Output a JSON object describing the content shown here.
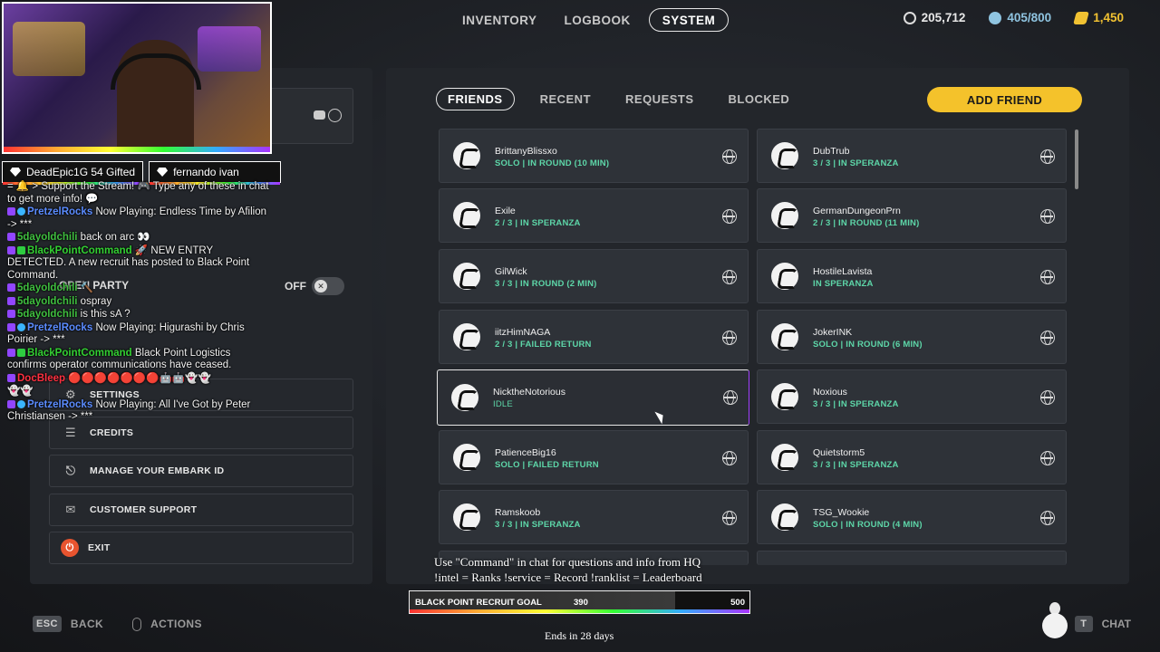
{
  "nav": {
    "tabs": [
      {
        "label": "INVENTORY"
      },
      {
        "label": "LOGBOOK"
      },
      {
        "label": "SYSTEM"
      }
    ]
  },
  "currencies": {
    "coins": "205,712",
    "capacity": "405/800",
    "premium": "1,450",
    "colors": {
      "capacity": "#8fc4e0",
      "premium": "#f1c232"
    }
  },
  "system_menu": {
    "party_label": "OPEN PARTY",
    "party_toggle": "OFF",
    "items": [
      {
        "label": "SETTINGS",
        "icon": "gear-icon"
      },
      {
        "label": "CREDITS",
        "icon": "list-icon"
      },
      {
        "label": "MANAGE YOUR EMBARK ID",
        "icon": "embark-icon"
      },
      {
        "label": "CUSTOMER SUPPORT",
        "icon": "chat-icon"
      },
      {
        "label": "EXIT",
        "icon": "power-icon"
      }
    ]
  },
  "stream": {
    "gifts": [
      {
        "text": "DeadEpic1G 54 Gifted"
      },
      {
        "text": "fernando ivan"
      }
    ],
    "chat": [
      {
        "user": "",
        "text": "= 🔔 > Support the Stream! 🎮 Type any of these in chat to get more info! 💬"
      },
      {
        "user": "PretzelRocks",
        "text": "Now Playing: Endless Time by Afilion -> ***"
      },
      {
        "user": "5dayoldchili",
        "text": "back on arc 👀"
      },
      {
        "user": "BlackPointCommand",
        "text": "🚀 NEW ENTRY DETECTED. A new recruit has posted to Black Point Command."
      },
      {
        "user": "5dayoldchili",
        "text": "🔨"
      },
      {
        "user": "5dayoldchili",
        "text": "ospray"
      },
      {
        "user": "5dayoldchili",
        "text": "is this sA ?"
      },
      {
        "user": "PretzelRocks",
        "text": "Now Playing: Higurashi by Chris Poirier -> ***"
      },
      {
        "user": "BlackPointCommand",
        "text": "Black Point Logistics confirms operator communications have ceased."
      },
      {
        "user": "DocBleep",
        "text": "🔴🔴🔴🔴🔴🔴🔴🤖🤖👻👻"
      },
      {
        "user": "",
        "text": "👻👻"
      },
      {
        "user": "PretzelRocks",
        "text": "Now Playing: All I've Got by Peter Christiansen -> ***"
      }
    ]
  },
  "friends": {
    "tabs": [
      {
        "label": "FRIENDS"
      },
      {
        "label": "RECENT"
      },
      {
        "label": "REQUESTS"
      },
      {
        "label": "BLOCKED"
      }
    ],
    "add_label": "ADD FRIEND",
    "accent": "#f4c22b",
    "list": [
      {
        "name": "BrittanyBlissxo",
        "status": "SOLO | IN ROUND (10 MIN)"
      },
      {
        "name": "DubTrub",
        "status": "3 / 3 | IN SPERANZA"
      },
      {
        "name": "Exile",
        "status": "2 / 3 | IN SPERANZA"
      },
      {
        "name": "GermanDungeonPrn",
        "status": "2 / 3 | IN ROUND (11 MIN)"
      },
      {
        "name": "GilWick",
        "status": "3 / 3 | IN ROUND (2 MIN)"
      },
      {
        "name": "HostileLavista",
        "status": "IN SPERANZA"
      },
      {
        "name": "iitzHimNAGA",
        "status": "2 / 3 | FAILED RETURN"
      },
      {
        "name": "JokerINK",
        "status": "SOLO | IN ROUND (6 MIN)"
      },
      {
        "name": "NicktheNotorious",
        "status": "IDLE"
      },
      {
        "name": "Noxious",
        "status": "3 / 3 | IN SPERANZA"
      },
      {
        "name": "PatienceBig16",
        "status": "SOLO | FAILED RETURN"
      },
      {
        "name": "Quietstorm5",
        "status": "3 / 3 | IN SPERANZA"
      },
      {
        "name": "Ramskoob",
        "status": "3 / 3 | IN SPERANZA"
      },
      {
        "name": "TSG_Wookie",
        "status": "SOLO | IN ROUND (4 MIN)"
      }
    ]
  },
  "overlay": {
    "command_line1": "Use \"Command\" in chat for questions and info from HQ",
    "command_line2": "!intel = Ranks !service = Record !ranklist = Leaderboard",
    "goal_label": "BLACK POINT RECRUIT GOAL",
    "goal_current": "390",
    "goal_max": "500",
    "goal_progress": 0.78,
    "ends": "Ends in 28 days"
  },
  "bottom": {
    "esc_key": "ESC",
    "back_label": "BACK",
    "actions_label": "ACTIONS",
    "chat_key": "T",
    "chat_label": "CHAT"
  }
}
